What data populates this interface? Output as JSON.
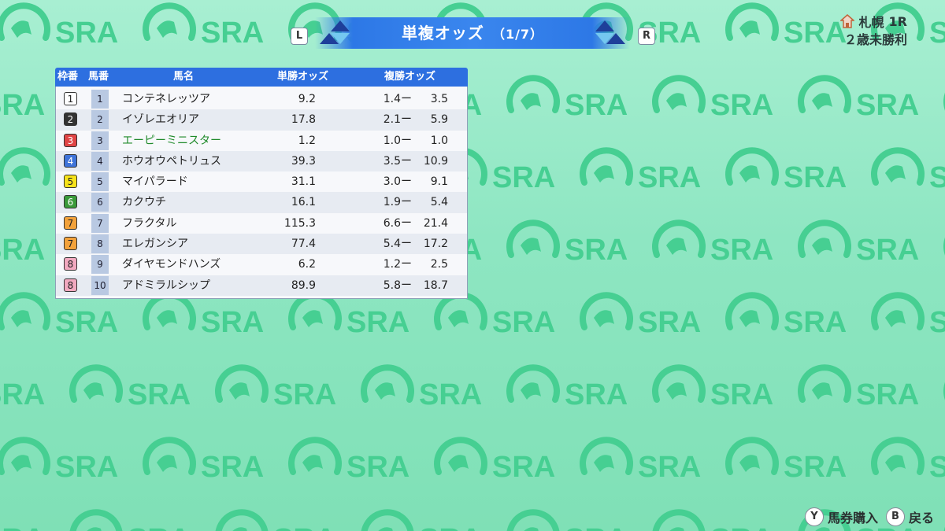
{
  "logo_text": "SRA",
  "header": {
    "title": "単複オッズ",
    "page": "（1/7）",
    "key_left": "L",
    "key_right": "R"
  },
  "race": {
    "venue": "札幌",
    "race_no": "1R",
    "class": "２歳未勝利"
  },
  "table": {
    "columns": [
      "枠番",
      "馬番",
      "馬名",
      "単勝オッズ",
      "複勝オッズ"
    ],
    "rows": [
      {
        "waku": "1",
        "umaban": "1",
        "name": "コンテネレッツア",
        "win": "9.2",
        "place_min": "1.4ー",
        "place_max": "3.5"
      },
      {
        "waku": "2",
        "umaban": "2",
        "name": "イゾレエオリア",
        "win": "17.8",
        "place_min": "2.1ー",
        "place_max": "5.9"
      },
      {
        "waku": "3",
        "umaban": "3",
        "name": "エーピーミニスター",
        "win": "1.2",
        "place_min": "1.0ー",
        "place_max": "1.0"
      },
      {
        "waku": "4",
        "umaban": "4",
        "name": "ホウオウペトリュス",
        "win": "39.3",
        "place_min": "3.5ー",
        "place_max": "10.9"
      },
      {
        "waku": "5",
        "umaban": "5",
        "name": "マイパラード",
        "win": "31.1",
        "place_min": "3.0ー",
        "place_max": "9.1"
      },
      {
        "waku": "6",
        "umaban": "6",
        "name": "カクウチ",
        "win": "16.1",
        "place_min": "1.9ー",
        "place_max": "5.4"
      },
      {
        "waku": "7",
        "umaban": "7",
        "name": "フラクタル",
        "win": "115.3",
        "place_min": "6.6ー",
        "place_max": "21.4"
      },
      {
        "waku": "7",
        "umaban": "8",
        "name": "エレガンシア",
        "win": "77.4",
        "place_min": "5.4ー",
        "place_max": "17.2"
      },
      {
        "waku": "8",
        "umaban": "9",
        "name": "ダイヤモンドハンズ",
        "win": "6.2",
        "place_min": "1.2ー",
        "place_max": "2.5"
      },
      {
        "waku": "8",
        "umaban": "10",
        "name": "アドミラルシップ",
        "win": "89.9",
        "place_min": "5.8ー",
        "place_max": "18.7"
      }
    ],
    "highlight_color": "#1f8a2a",
    "waku_colors": {
      "1": {
        "bg": "#ffffff",
        "fg": "#222222"
      },
      "2": {
        "bg": "#333333",
        "fg": "#ffffff"
      },
      "3": {
        "bg": "#e04545",
        "fg": "#ffffff"
      },
      "4": {
        "bg": "#3f74d9",
        "fg": "#ffffff"
      },
      "5": {
        "bg": "#f6e21a",
        "fg": "#222222"
      },
      "6": {
        "bg": "#3a9a3a",
        "fg": "#ffffff"
      },
      "7": {
        "bg": "#f3a23b",
        "fg": "#222222"
      },
      "8": {
        "bg": "#f2a9c0",
        "fg": "#222222"
      }
    }
  },
  "hints": {
    "y_key": "Y",
    "y_label": "馬券購入",
    "b_key": "B",
    "b_label": "戻る"
  }
}
